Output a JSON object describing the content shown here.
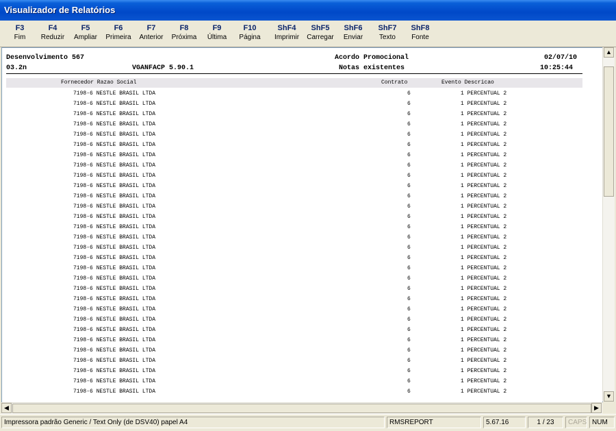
{
  "window": {
    "title": "Visualizador de Relatórios"
  },
  "toolbar": [
    {
      "key": "F3",
      "label": "Fim"
    },
    {
      "key": "F4",
      "label": "Reduzir"
    },
    {
      "key": "F5",
      "label": "Ampliar"
    },
    {
      "key": "F6",
      "label": "Primeira"
    },
    {
      "key": "F7",
      "label": "Anterior"
    },
    {
      "key": "F8",
      "label": "Próxima"
    },
    {
      "key": "F9",
      "label": "Última"
    },
    {
      "key": "F10",
      "label": "Página"
    },
    {
      "key": "ShF4",
      "label": "Imprimir"
    },
    {
      "key": "ShF5",
      "label": "Carregar"
    },
    {
      "key": "ShF6",
      "label": "Enviar"
    },
    {
      "key": "ShF7",
      "label": "Texto"
    },
    {
      "key": "ShF8",
      "label": "Fonte"
    }
  ],
  "report": {
    "company": "Desenvolvimento 567",
    "version_code": "03.2n",
    "program": "VGANFACP 5.90.1",
    "title": "Acordo Promocional",
    "subtitle": "Notas existentes",
    "date": "02/07/10",
    "time": "10:25:44",
    "columns": {
      "supplier": "Fornecedor Razao Social",
      "contract": "Contrato",
      "event": "Evento Descricao"
    },
    "rows": [
      {
        "supplier": "7198-6 NESTLE BRASIL LTDA",
        "contract": "6",
        "event": "1 PERCENTUAL 2"
      },
      {
        "supplier": "7198-6 NESTLE BRASIL LTDA",
        "contract": "6",
        "event": "1 PERCENTUAL 2"
      },
      {
        "supplier": "7198-6 NESTLE BRASIL LTDA",
        "contract": "6",
        "event": "1 PERCENTUAL 2"
      },
      {
        "supplier": "7198-6 NESTLE BRASIL LTDA",
        "contract": "6",
        "event": "1 PERCENTUAL 2"
      },
      {
        "supplier": "7198-6 NESTLE BRASIL LTDA",
        "contract": "6",
        "event": "1 PERCENTUAL 2"
      },
      {
        "supplier": "7198-6 NESTLE BRASIL LTDA",
        "contract": "6",
        "event": "1 PERCENTUAL 2"
      },
      {
        "supplier": "7198-6 NESTLE BRASIL LTDA",
        "contract": "6",
        "event": "1 PERCENTUAL 2"
      },
      {
        "supplier": "7198-6 NESTLE BRASIL LTDA",
        "contract": "6",
        "event": "1 PERCENTUAL 2"
      },
      {
        "supplier": "7198-6 NESTLE BRASIL LTDA",
        "contract": "6",
        "event": "1 PERCENTUAL 2"
      },
      {
        "supplier": "7198-6 NESTLE BRASIL LTDA",
        "contract": "6",
        "event": "1 PERCENTUAL 2"
      },
      {
        "supplier": "7198-6 NESTLE BRASIL LTDA",
        "contract": "6",
        "event": "1 PERCENTUAL 2"
      },
      {
        "supplier": "7198-6 NESTLE BRASIL LTDA",
        "contract": "6",
        "event": "1 PERCENTUAL 2"
      },
      {
        "supplier": "7198-6 NESTLE BRASIL LTDA",
        "contract": "6",
        "event": "1 PERCENTUAL 2"
      },
      {
        "supplier": "7198-6 NESTLE BRASIL LTDA",
        "contract": "6",
        "event": "1 PERCENTUAL 2"
      },
      {
        "supplier": "7198-6 NESTLE BRASIL LTDA",
        "contract": "6",
        "event": "1 PERCENTUAL 2"
      },
      {
        "supplier": "7198-6 NESTLE BRASIL LTDA",
        "contract": "6",
        "event": "1 PERCENTUAL 2"
      },
      {
        "supplier": "7198-6 NESTLE BRASIL LTDA",
        "contract": "6",
        "event": "1 PERCENTUAL 2"
      },
      {
        "supplier": "7198-6 NESTLE BRASIL LTDA",
        "contract": "6",
        "event": "1 PERCENTUAL 2"
      },
      {
        "supplier": "7198-6 NESTLE BRASIL LTDA",
        "contract": "6",
        "event": "1 PERCENTUAL 2"
      },
      {
        "supplier": "7198-6 NESTLE BRASIL LTDA",
        "contract": "6",
        "event": "1 PERCENTUAL 2"
      },
      {
        "supplier": "7198-6 NESTLE BRASIL LTDA",
        "contract": "6",
        "event": "1 PERCENTUAL 2"
      },
      {
        "supplier": "7198-6 NESTLE BRASIL LTDA",
        "contract": "6",
        "event": "1 PERCENTUAL 2"
      },
      {
        "supplier": "7198-6 NESTLE BRASIL LTDA",
        "contract": "6",
        "event": "1 PERCENTUAL 2"
      },
      {
        "supplier": "7198-6 NESTLE BRASIL LTDA",
        "contract": "6",
        "event": "1 PERCENTUAL 2"
      },
      {
        "supplier": "7198-6 NESTLE BRASIL LTDA",
        "contract": "6",
        "event": "1 PERCENTUAL 2"
      },
      {
        "supplier": "7198-6 NESTLE BRASIL LTDA",
        "contract": "6",
        "event": "1 PERCENTUAL 2"
      },
      {
        "supplier": "7198-6 NESTLE BRASIL LTDA",
        "contract": "6",
        "event": "1 PERCENTUAL 2"
      },
      {
        "supplier": "7198-6 NESTLE BRASIL LTDA",
        "contract": "6",
        "event": "1 PERCENTUAL 2"
      },
      {
        "supplier": "7198-6 NESTLE BRASIL LTDA",
        "contract": "6",
        "event": "1 PERCENTUAL 2"
      },
      {
        "supplier": "7198-6 NESTLE BRASIL LTDA",
        "contract": "6",
        "event": "1 PERCENTUAL 2"
      }
    ]
  },
  "scrollbars": {
    "up_arrow_icon": "up-arrow-icon",
    "down_arrow_icon": "down-arrow-icon",
    "left_arrow_icon": "left-arrow-icon",
    "right_arrow_icon": "right-arrow-icon",
    "up_glyph": "▲",
    "down_glyph": "▼",
    "left_glyph": "◀",
    "right_glyph": "▶"
  },
  "status": {
    "printer": "Impressora padrão Generic / Text Only (de DSV40) papel A4",
    "report_name": "RMSREPORT",
    "version": "5.67.16",
    "page": "1 / 23",
    "caps": "CAPS",
    "num": "NUM"
  }
}
